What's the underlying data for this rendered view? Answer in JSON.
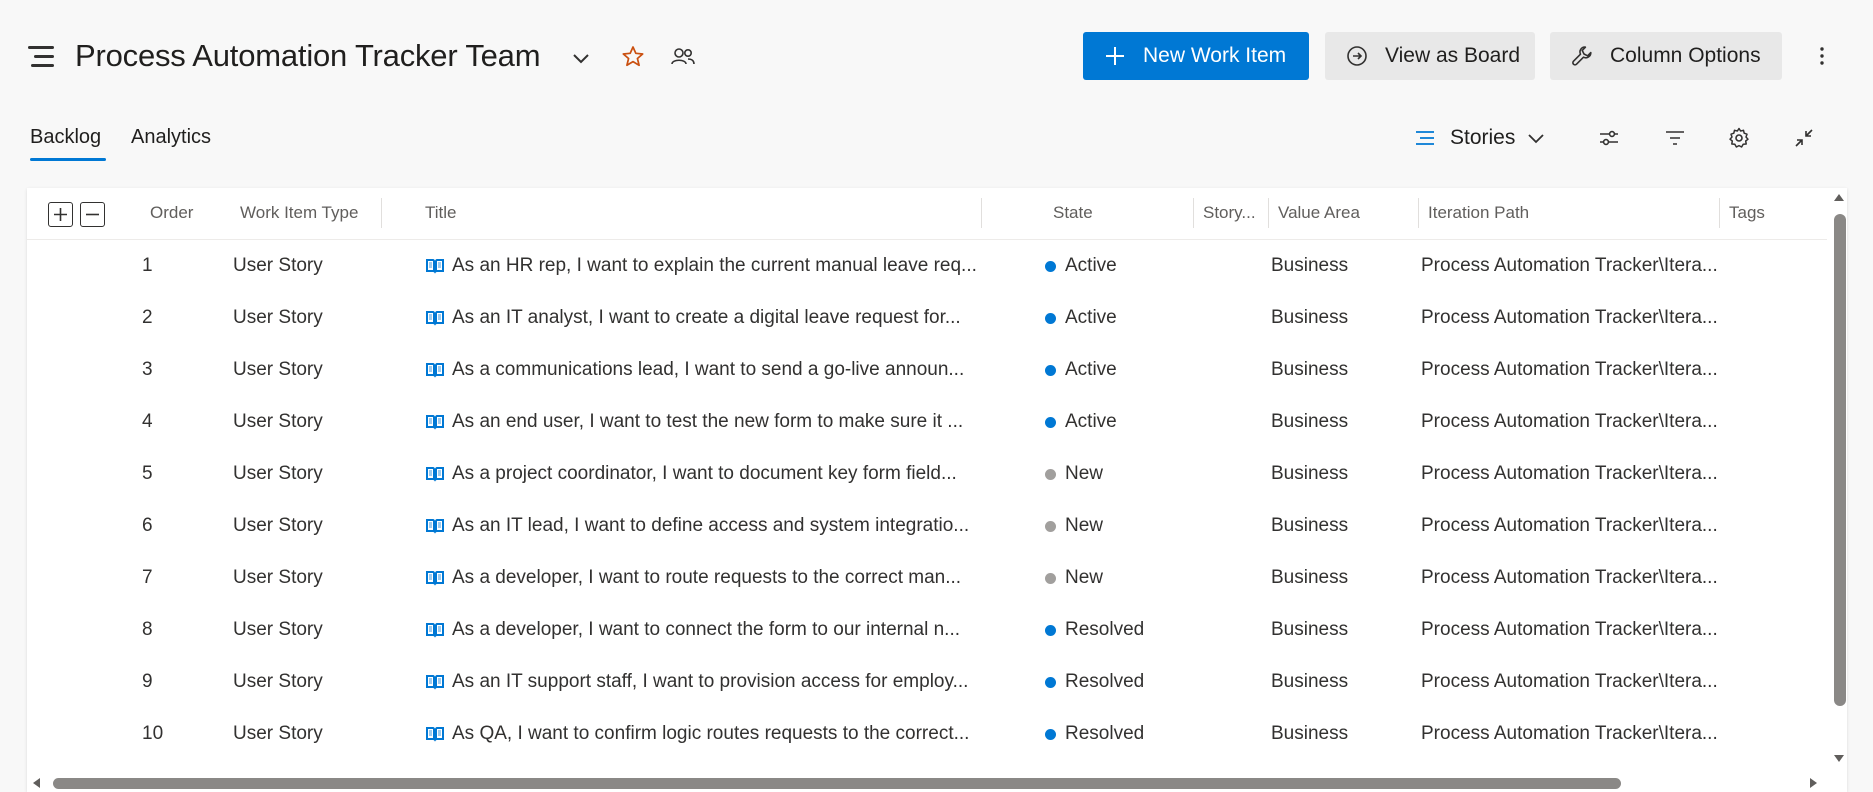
{
  "header": {
    "team_title": "Process Automation Tracker Team",
    "new_work_item_label": "New Work Item",
    "view_as_board_label": "View as Board",
    "column_options_label": "Column Options"
  },
  "tabs": [
    {
      "label": "Backlog",
      "selected": true
    },
    {
      "label": "Analytics",
      "selected": false
    }
  ],
  "toolbar": {
    "backlog_level": "Stories"
  },
  "colors": {
    "accent": "#0078d4",
    "star": "#ca5010",
    "state_active": "#0078d4",
    "state_resolved": "#0078d4",
    "state_new": "#a19f9d"
  },
  "columns": {
    "order": "Order",
    "work_item_type": "Work Item Type",
    "title": "Title",
    "state": "State",
    "story_points": "Story...",
    "value_area": "Value Area",
    "iteration_path": "Iteration Path",
    "tags": "Tags"
  },
  "rows": [
    {
      "order": "1",
      "type": "User Story",
      "title": "As an HR rep, I want to explain the current manual leave req...",
      "state": "Active",
      "value_area": "Business",
      "iteration_path": "Process Automation Tracker\\Itera..."
    },
    {
      "order": "2",
      "type": "User Story",
      "title": "As an IT analyst, I want to create a digital leave request for...",
      "state": "Active",
      "value_area": "Business",
      "iteration_path": "Process Automation Tracker\\Itera..."
    },
    {
      "order": "3",
      "type": "User Story",
      "title": "As a communications lead, I want to send a go-live announ...",
      "state": "Active",
      "value_area": "Business",
      "iteration_path": "Process Automation Tracker\\Itera..."
    },
    {
      "order": "4",
      "type": "User Story",
      "title": "As an end user, I want to test the new form to make sure it ...",
      "state": "Active",
      "value_area": "Business",
      "iteration_path": "Process Automation Tracker\\Itera..."
    },
    {
      "order": "5",
      "type": "User Story",
      "title": "As a project coordinator, I want to document key form field...",
      "state": "New",
      "value_area": "Business",
      "iteration_path": "Process Automation Tracker\\Itera..."
    },
    {
      "order": "6",
      "type": "User Story",
      "title": "As an IT lead, I want to define access and system integratio...",
      "state": "New",
      "value_area": "Business",
      "iteration_path": "Process Automation Tracker\\Itera..."
    },
    {
      "order": "7",
      "type": "User Story",
      "title": "As a developer, I want to route requests to the correct man...",
      "state": "New",
      "value_area": "Business",
      "iteration_path": "Process Automation Tracker\\Itera..."
    },
    {
      "order": "8",
      "type": "User Story",
      "title": "As a developer, I want to connect the form to our internal n...",
      "state": "Resolved",
      "value_area": "Business",
      "iteration_path": "Process Automation Tracker\\Itera..."
    },
    {
      "order": "9",
      "type": "User Story",
      "title": "As an IT support staff, I want to provision access for employ...",
      "state": "Resolved",
      "value_area": "Business",
      "iteration_path": "Process Automation Tracker\\Itera..."
    },
    {
      "order": "10",
      "type": "User Story",
      "title": "As QA, I want to confirm logic routes requests to the correct...",
      "state": "Resolved",
      "value_area": "Business",
      "iteration_path": "Process Automation Tracker\\Itera..."
    }
  ]
}
